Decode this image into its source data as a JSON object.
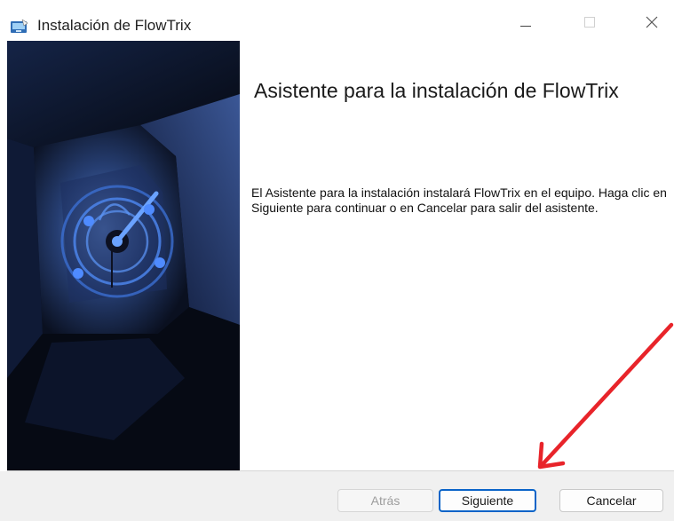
{
  "window": {
    "title": "Instalación de FlowTrix",
    "controls": {
      "minimize": "—",
      "maximize": "☐",
      "close": "✕"
    }
  },
  "content": {
    "heading": "Asistente para la instalación de FlowTrix",
    "description": "El Asistente para la instalación instalará FlowTrix en el equipo. Haga clic en Siguiente para continuar o en Cancelar para salir del asistente."
  },
  "footer": {
    "back_label": "Atrás",
    "next_label": "Siguiente",
    "cancel_label": "Cancelar"
  },
  "colors": {
    "accent": "#0a64c8",
    "annotation_arrow": "#e8242a",
    "banner_dark": "#0b1122",
    "banner_mid": "#27406f"
  },
  "icons": {
    "app": "installer-icon",
    "banner": "clock-orbit-logo"
  }
}
